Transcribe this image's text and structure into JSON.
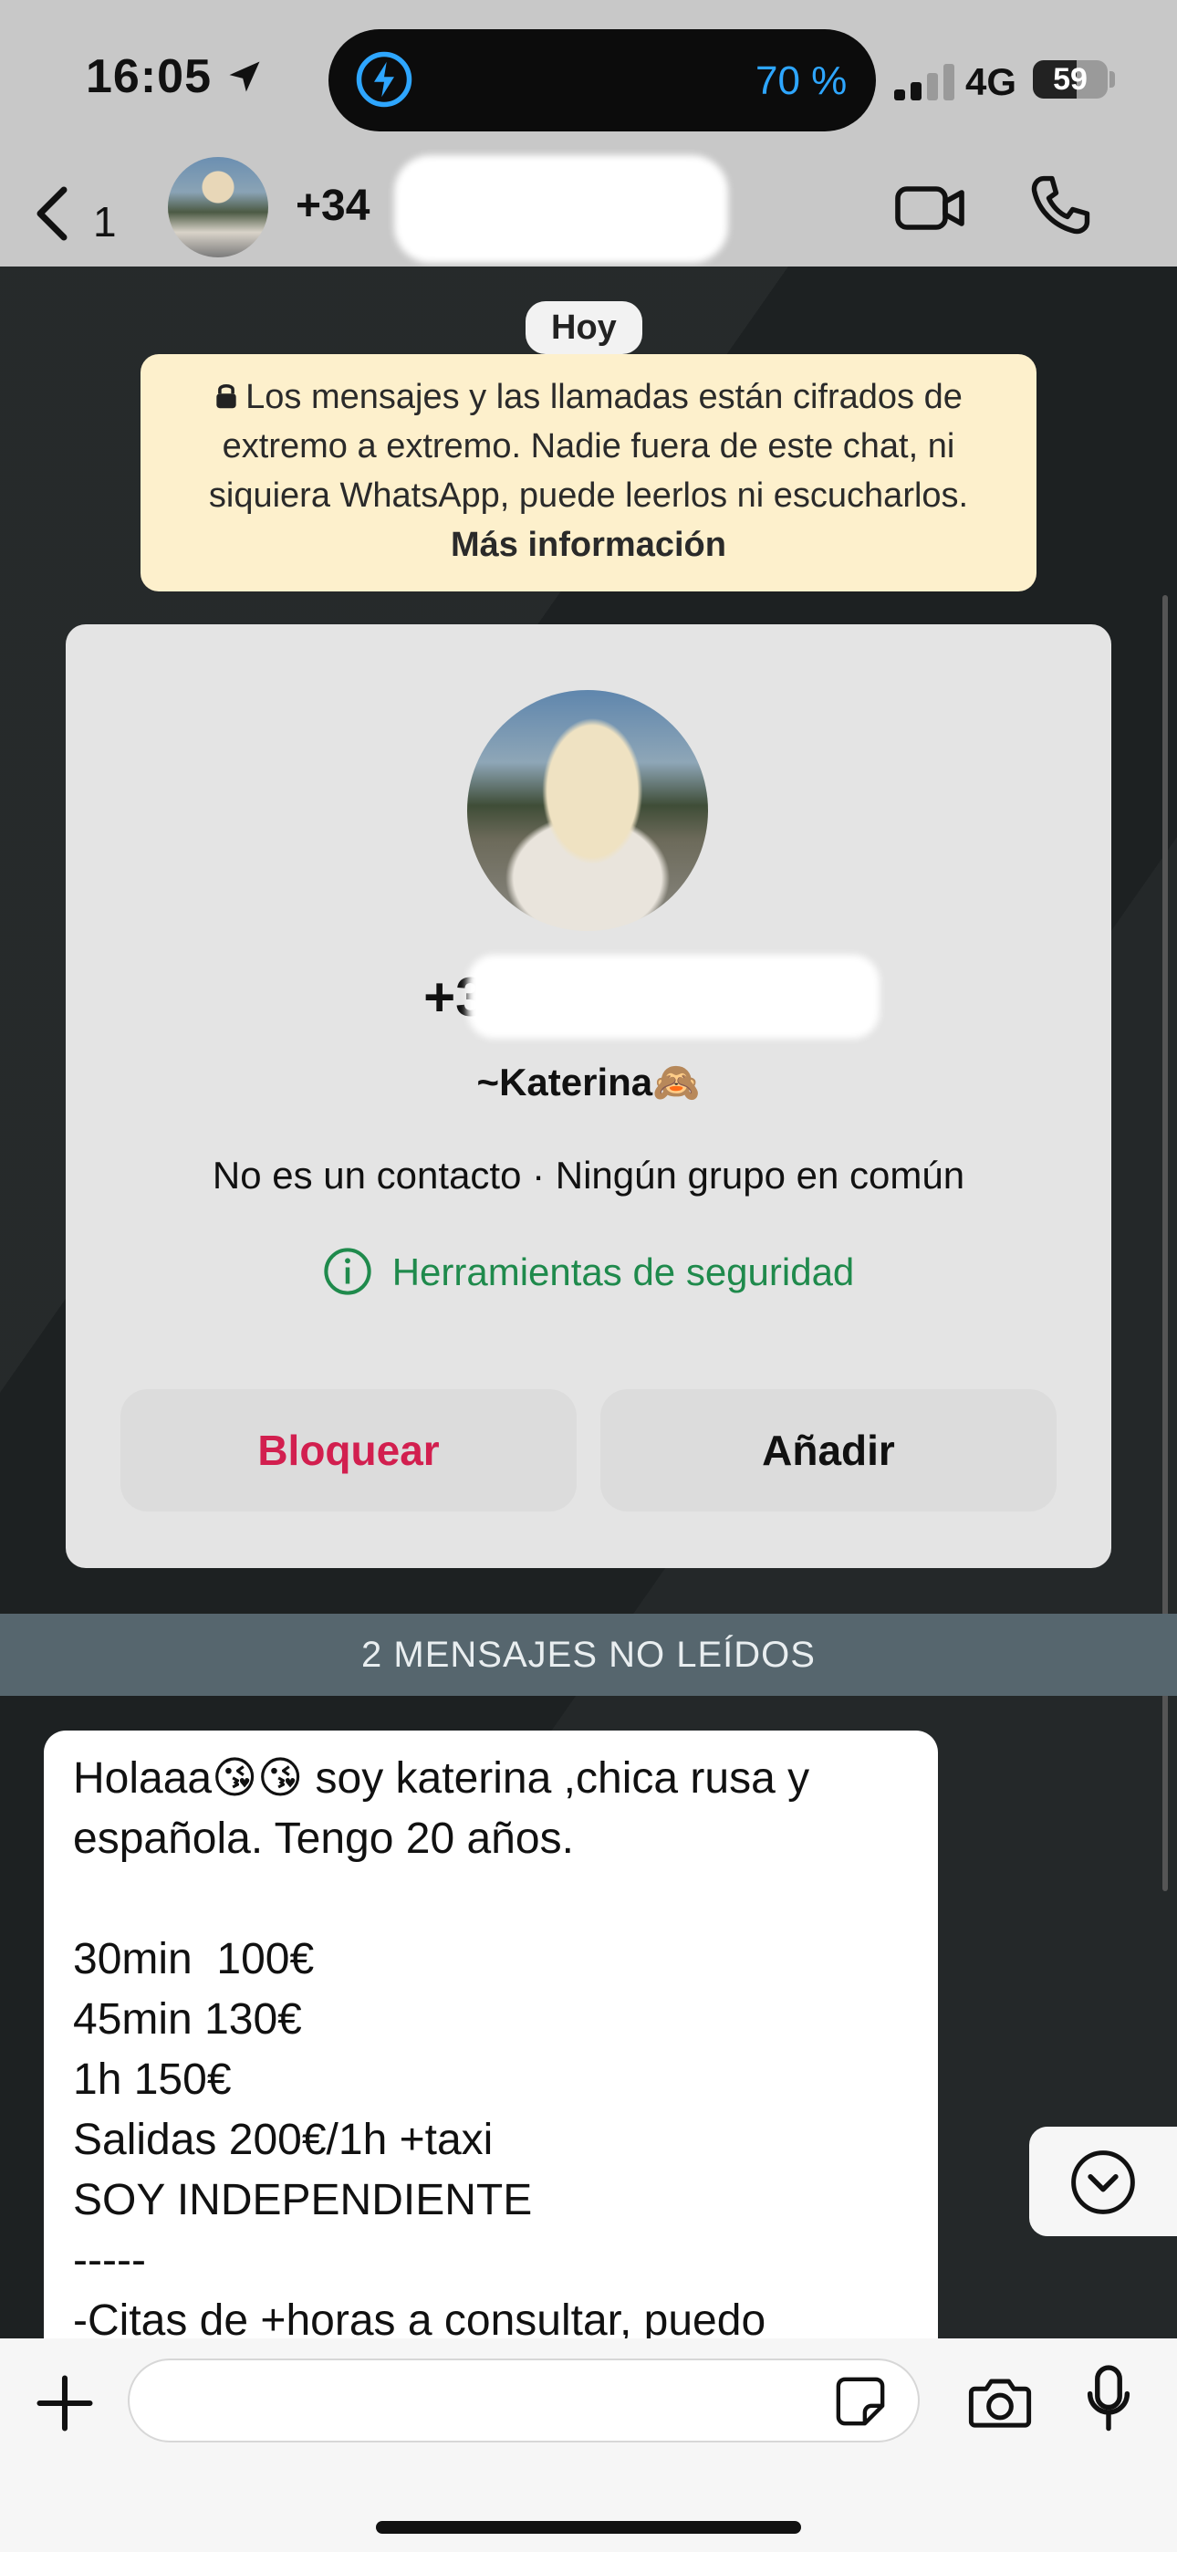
{
  "status_bar": {
    "time": "16:05",
    "battery_percent_label": "70 %",
    "network": "4G",
    "battery_level": "59",
    "battery_level_fraction": 0.59
  },
  "header": {
    "back_count": "1",
    "title": "+34 "
  },
  "chat": {
    "date_pill": "Hoy",
    "encryption_notice": "Los mensajes y las llamadas están cifrados de extremo a extremo. Nadie fuera de este chat, ni siquiera WhatsApp, puede leerlos ni escucharlos.",
    "encryption_link": "Más información",
    "contact_card": {
      "phone": "+34 ",
      "name": "~Katerina🙈",
      "meta": "No es un contacto · Ningún grupo en común",
      "security_link": "Herramientas de seguridad",
      "block_label": "Bloquear",
      "add_label": "Añadir"
    },
    "unread_banner": "2 MENSAJES NO LEÍDOS",
    "message_text": "Holaaa😘😘 soy katerina ,chica rusa y española. Tengo 20 años.\n\n30min  100€\n45min 130€\n1h 150€\nSalidas 200€/1h +taxi\nSOY INDEPENDIENTE\n-----\n-Citas de +horas a consultar, puedo"
  },
  "composer": {
    "placeholder": ""
  },
  "colors": {
    "accent_green": "#1f8a4c",
    "block_red": "#d21f4f",
    "battery_blue": "#2ea6ff",
    "notice_yellow": "#fdf0cc"
  }
}
